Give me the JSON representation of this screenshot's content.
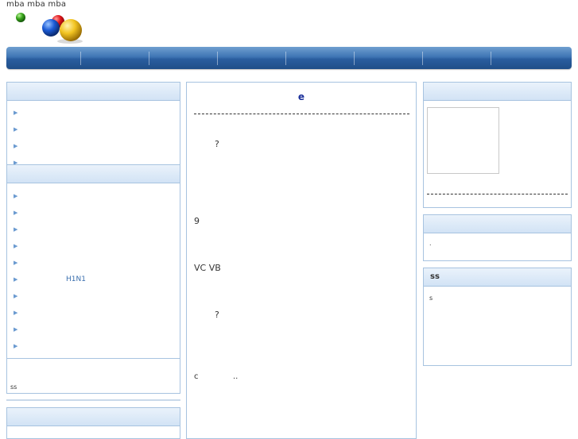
{
  "header": {
    "site_title": "mba mba mba"
  },
  "nav": {
    "items": [
      "",
      "",
      "",
      "",
      "",
      "",
      "",
      ""
    ]
  },
  "left_column": {
    "panel1": {
      "items": [
        "",
        "",
        "",
        ""
      ]
    },
    "panel2": {
      "items": [
        "",
        "",
        "",
        "",
        "",
        "H1N1",
        "",
        "",
        "",
        ""
      ],
      "footer_text": "ss"
    }
  },
  "main": {
    "title": "e",
    "lines": [
      "?",
      "9",
      "VC VB",
      "?",
      "c",
      ".."
    ]
  },
  "right_column": {
    "panel2_text": ".",
    "panel3_title": "ss",
    "panel3_text": "s"
  },
  "colors": {
    "nav_bar": "#2a5e9f",
    "panel_border": "#a7c3e0",
    "link": "#3a6fae",
    "title_accent": "#1a2f9a"
  }
}
